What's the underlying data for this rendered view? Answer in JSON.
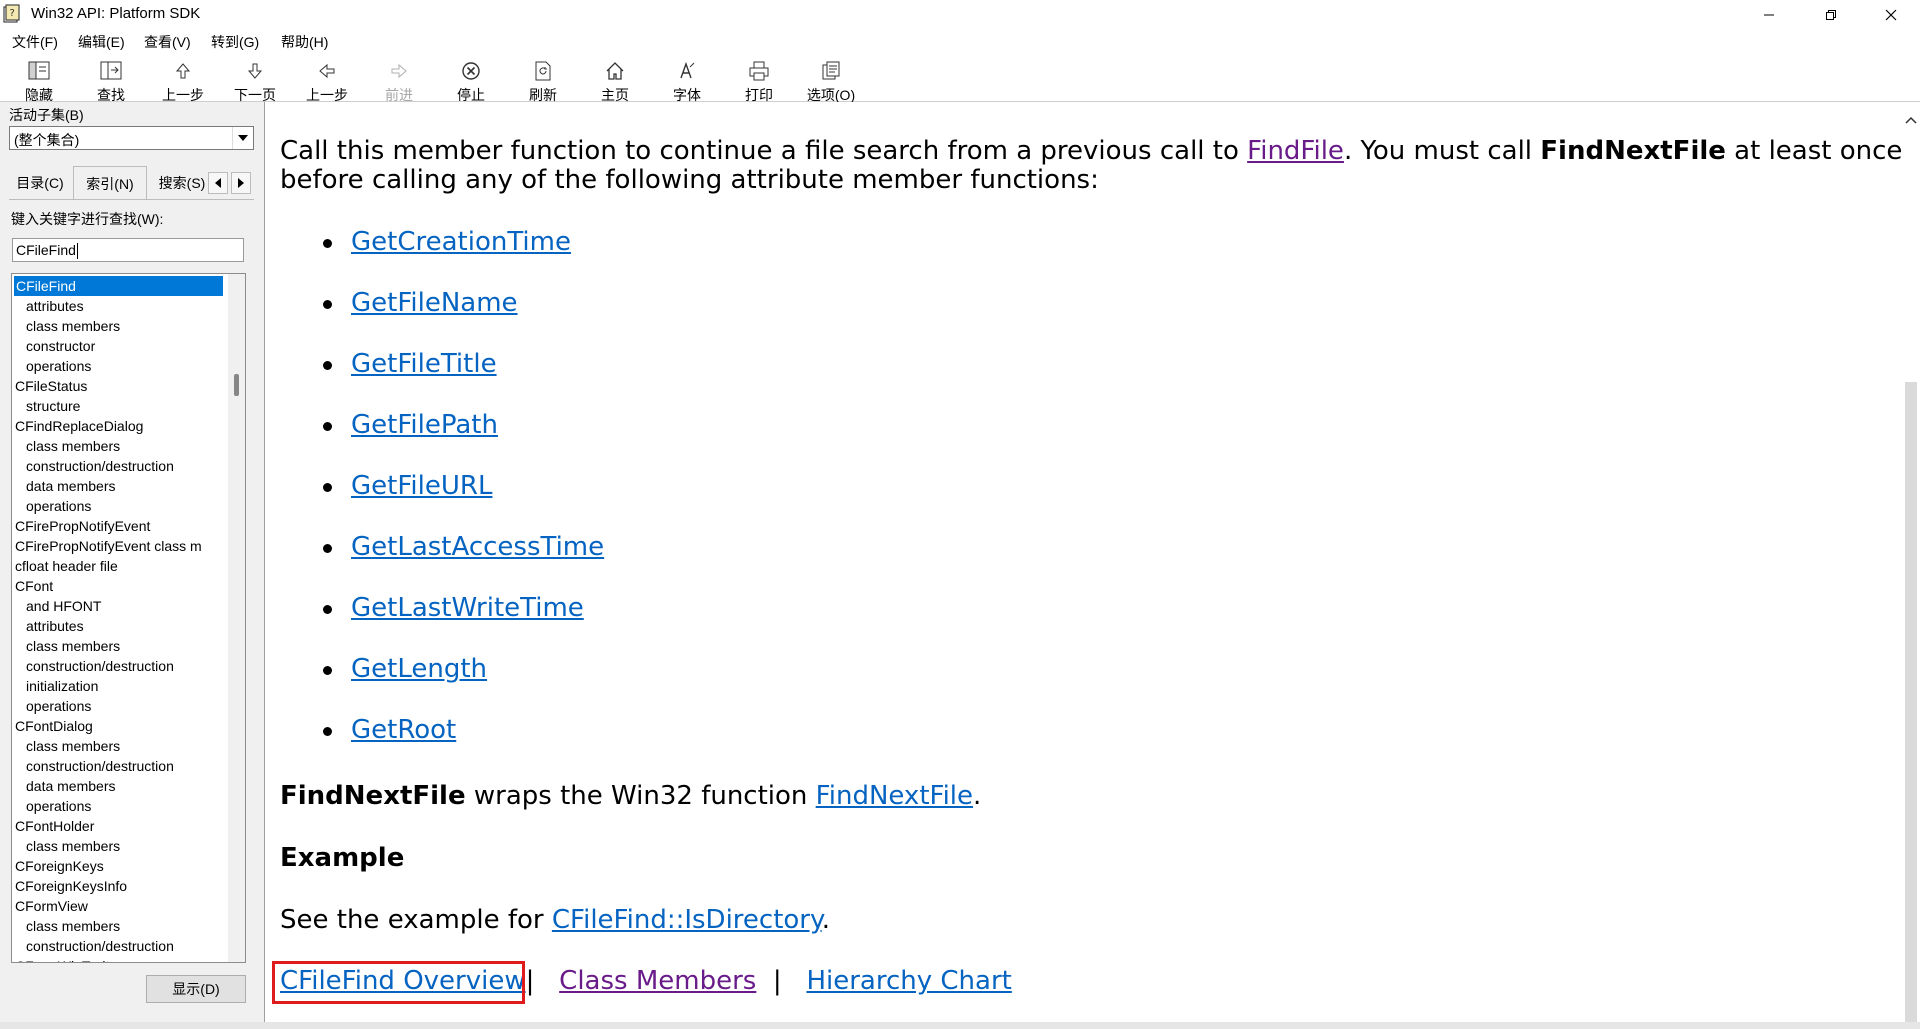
{
  "window": {
    "title": "Win32 API: Platform SDK",
    "icon": "help-book-icon",
    "controls": [
      "minimize-icon",
      "maximize-icon",
      "close-icon"
    ]
  },
  "menu": [
    {
      "label": "文件(F)"
    },
    {
      "label": "编辑(E)"
    },
    {
      "label": "查看(V)"
    },
    {
      "label": "转到(G)"
    },
    {
      "label": "帮助(H)"
    }
  ],
  "toolbar": [
    {
      "label": "隐藏",
      "icon": "hide-pane-icon",
      "enabled": true
    },
    {
      "label": "查找",
      "icon": "locate-icon",
      "enabled": true
    },
    {
      "label": "上一步",
      "icon": "up-arrow-icon",
      "enabled": true
    },
    {
      "label": "下一页",
      "icon": "down-arrow-icon",
      "enabled": true
    },
    {
      "label": "上一步",
      "icon": "back-arrow-icon",
      "enabled": true
    },
    {
      "label": "前进",
      "icon": "forward-arrow-icon",
      "enabled": false
    },
    {
      "label": "停止",
      "icon": "stop-icon",
      "enabled": true
    },
    {
      "label": "刷新",
      "icon": "refresh-icon",
      "enabled": true
    },
    {
      "label": "主页",
      "icon": "home-icon",
      "enabled": true
    },
    {
      "label": "字体",
      "icon": "font-icon",
      "enabled": true
    },
    {
      "label": "打印",
      "icon": "print-icon",
      "enabled": true
    },
    {
      "label": "选项(O)",
      "icon": "options-icon",
      "enabled": true
    }
  ],
  "left_pane": {
    "subset_label": "活动子集(B)",
    "subset_value": "(整个集合)",
    "tabs": [
      {
        "label": "目录(C)",
        "active": false
      },
      {
        "label": "索引(N)",
        "active": true
      },
      {
        "label": "搜索(S)",
        "active": false
      }
    ],
    "keyword_label": "键入关键字进行查找(W):",
    "keyword_value": "CFileFind",
    "index_items": [
      {
        "text": "CFileFind",
        "level": 0,
        "selected": true
      },
      {
        "text": "attributes",
        "level": 1
      },
      {
        "text": "class members",
        "level": 1
      },
      {
        "text": "constructor",
        "level": 1
      },
      {
        "text": "operations",
        "level": 1
      },
      {
        "text": "CFileStatus",
        "level": 0
      },
      {
        "text": "structure",
        "level": 1
      },
      {
        "text": "CFindReplaceDialog",
        "level": 0
      },
      {
        "text": "class members",
        "level": 1
      },
      {
        "text": "construction/destruction",
        "level": 1
      },
      {
        "text": "data members",
        "level": 1
      },
      {
        "text": "operations",
        "level": 1
      },
      {
        "text": "CFirePropNotifyEvent",
        "level": 0
      },
      {
        "text": "CFirePropNotifyEvent class m",
        "level": 0
      },
      {
        "text": "cfloat header file",
        "level": 0
      },
      {
        "text": "CFont",
        "level": 0
      },
      {
        "text": "and HFONT",
        "level": 1
      },
      {
        "text": "attributes",
        "level": 1
      },
      {
        "text": "class members",
        "level": 1
      },
      {
        "text": "construction/destruction",
        "level": 1
      },
      {
        "text": "initialization",
        "level": 1
      },
      {
        "text": "operations",
        "level": 1
      },
      {
        "text": "CFontDialog",
        "level": 0
      },
      {
        "text": "class members",
        "level": 1
      },
      {
        "text": "construction/destruction",
        "level": 1
      },
      {
        "text": "data members",
        "level": 1
      },
      {
        "text": "operations",
        "level": 1
      },
      {
        "text": "CFontHolder",
        "level": 0
      },
      {
        "text": "class members",
        "level": 1
      },
      {
        "text": "CForeignKeys",
        "level": 0
      },
      {
        "text": "CForeignKeysInfo",
        "level": 0
      },
      {
        "text": "CFormView",
        "level": 0
      },
      {
        "text": "class members",
        "level": 1
      },
      {
        "text": "construction/destruction",
        "level": 1
      },
      {
        "text": "CFormWinTrait",
        "level": 0
      }
    ],
    "show_button": "显示(D)"
  },
  "content": {
    "intro_1": "Call this member function to continue a file search from a previous call to ",
    "intro_link": "FindFile",
    "intro_2": ". You must call ",
    "intro_bold": "FindNextFile",
    "intro_3": " at least once",
    "intro_line2": "before calling any of the following attribute member functions:",
    "functions": [
      "GetCreationTime",
      "GetFileName",
      "GetFileTitle",
      "GetFilePath",
      "GetFileURL",
      "GetLastAccessTime",
      "GetLastWriteTime",
      "GetLength",
      "GetRoot"
    ],
    "wraps_bold": "FindNextFile",
    "wraps_text": " wraps the Win32 function ",
    "wraps_link": "FindNextFile",
    "wraps_end": ".",
    "example_heading": "Example",
    "example_text": "See the example for ",
    "example_link": "CFileFind::IsDirectory",
    "example_end": ".",
    "footer_links": [
      {
        "label": "CFileFind Overview",
        "highlighted": true,
        "visited": false
      },
      {
        "label": "Class Members",
        "highlighted": false,
        "visited": true
      },
      {
        "label": "Hierarchy Chart",
        "highlighted": false,
        "visited": false
      }
    ],
    "separator": "|"
  },
  "colors": {
    "link": "#0563c1",
    "visited": "#6a1b8a",
    "selection": "#0078d7",
    "highlight_box": "#e01b1b"
  }
}
